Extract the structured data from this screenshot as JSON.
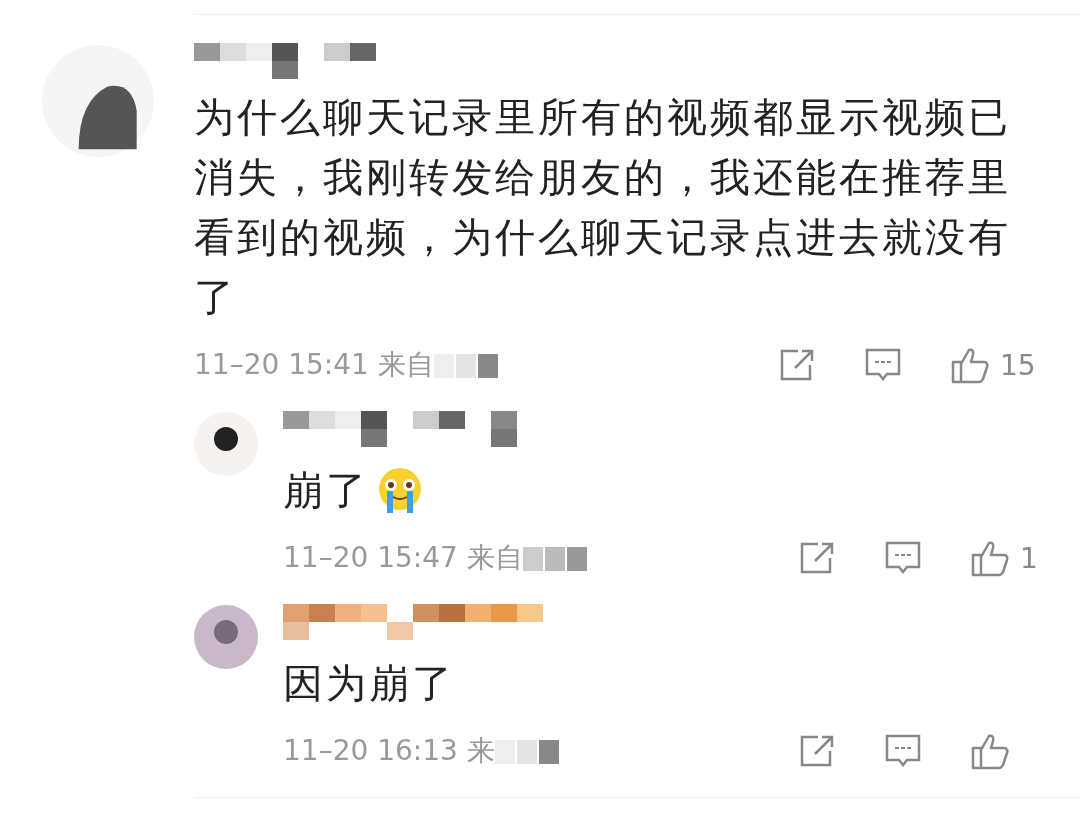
{
  "comment": {
    "text": "为什么聊天记录里所有的视频都显示视频已消失，我刚转发给朋友的，我还能在推荐里看到的视频，为什么聊天记录点进去就没有了",
    "time": "11–20 15:41 来自",
    "likes": "15",
    "replies": [
      {
        "text": "崩了",
        "emoji": true,
        "time": "11–20 15:47 来自",
        "likes": "1"
      },
      {
        "text": "因为崩了",
        "emoji": false,
        "time": "11–20 16:13 来"
      }
    ]
  }
}
